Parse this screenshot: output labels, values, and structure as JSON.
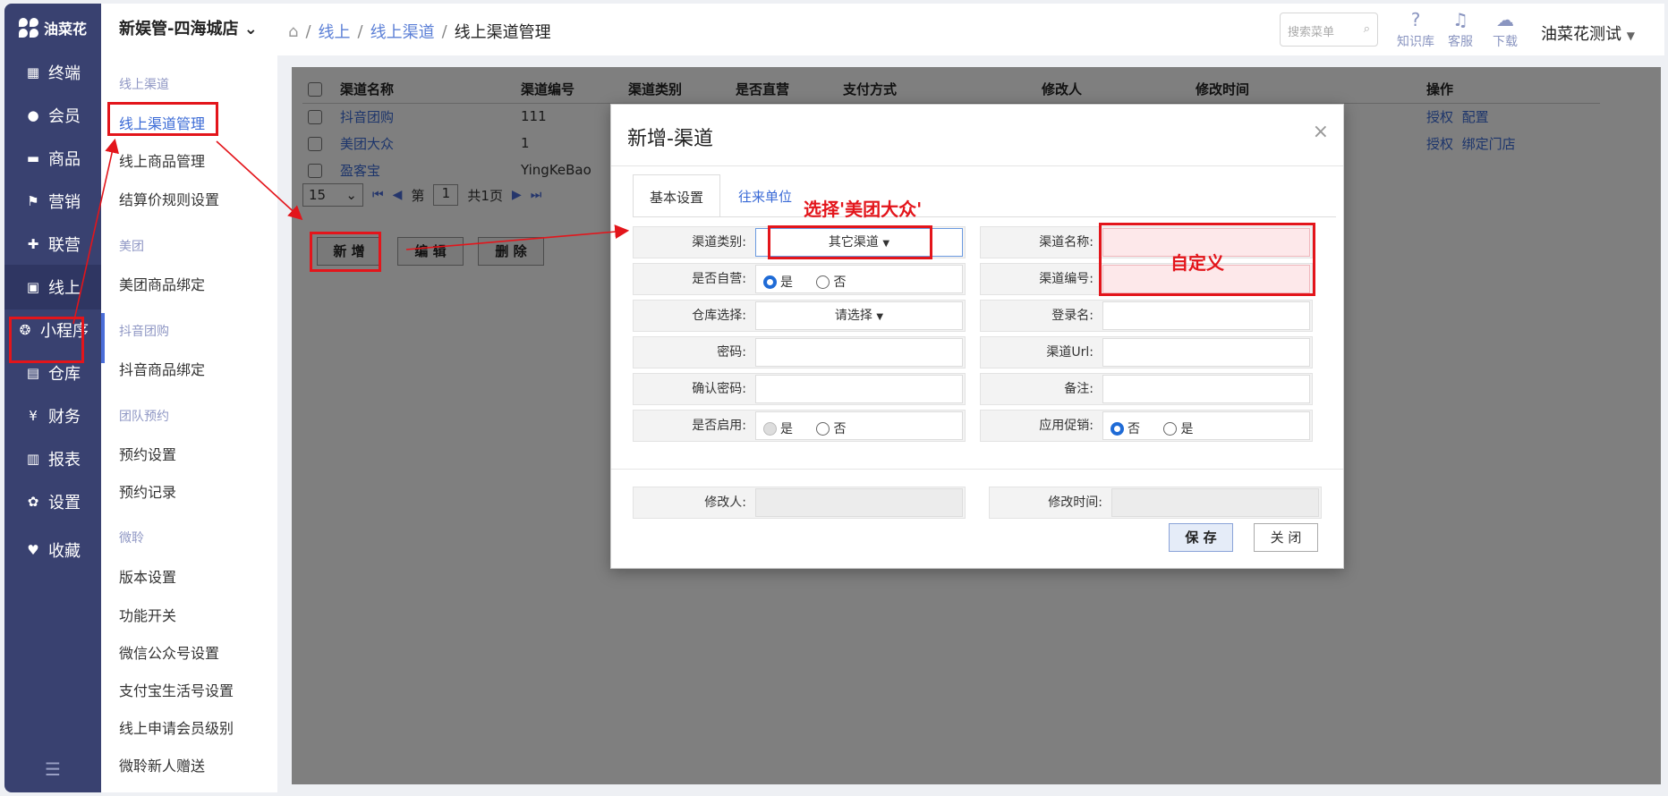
{
  "left_nav": {
    "logo": "油菜花",
    "items": [
      {
        "label": "终端",
        "icon": "terminal-icon",
        "glyph": "▦"
      },
      {
        "label": "会员",
        "icon": "member-icon",
        "glyph": "●"
      },
      {
        "label": "商品",
        "icon": "goods-icon",
        "glyph": "▬"
      },
      {
        "label": "营销",
        "icon": "flag-icon",
        "glyph": "⚑"
      },
      {
        "label": "联营",
        "icon": "union-icon",
        "glyph": "✚"
      },
      {
        "label": "线上",
        "icon": "online-icon",
        "glyph": "▣"
      },
      {
        "label": "小程序",
        "icon": "miniapp-icon",
        "glyph": "❂"
      },
      {
        "label": "仓库",
        "icon": "warehouse-icon",
        "glyph": "▤"
      },
      {
        "label": "财务",
        "icon": "finance-icon",
        "glyph": "¥"
      },
      {
        "label": "报表",
        "icon": "report-icon",
        "glyph": "▥"
      },
      {
        "label": "设置",
        "icon": "settings-icon",
        "glyph": "✿"
      },
      {
        "label": "收藏",
        "icon": "favorite-icon",
        "glyph": "♥"
      }
    ],
    "collapse_icon": "menu-collapse-icon"
  },
  "sub_nav": {
    "store": "新娱管-四海城店",
    "groups": [
      {
        "title": "线上渠道",
        "items": [
          "线上渠道管理",
          "线上商品管理",
          "结算价规则设置"
        ]
      },
      {
        "title": "美团",
        "items": [
          "美团商品绑定"
        ]
      },
      {
        "title": "抖音团购",
        "items": [
          "抖音商品绑定"
        ]
      },
      {
        "title": "团队预约",
        "items": [
          "预约设置",
          "预约记录"
        ]
      },
      {
        "title": "微聆",
        "items": [
          "版本设置",
          "功能开关",
          "微信公众号设置",
          "支付宝生活号设置",
          "线上申请会员级别",
          "微聆新人赠送"
        ]
      }
    ]
  },
  "top_bar": {
    "breadcrumb": [
      "线上",
      "线上渠道",
      "线上渠道管理"
    ],
    "search_placeholder": "搜索菜单",
    "icons": [
      {
        "label": "知识库",
        "icon": "help-icon",
        "glyph": "?"
      },
      {
        "label": "客服",
        "icon": "headset-icon",
        "glyph": "♫"
      },
      {
        "label": "下载",
        "icon": "cloud-download-icon",
        "glyph": "☁"
      }
    ],
    "user": "油菜花测试"
  },
  "table": {
    "headers": [
      "渠道名称",
      "渠道编号",
      "渠道类别",
      "是否直营",
      "支付方式",
      "修改人",
      "修改时间",
      "操作"
    ],
    "rows": [
      {
        "name": "抖音团购",
        "code": "111",
        "ops": [
          "授权",
          "配置"
        ]
      },
      {
        "name": "美团大众",
        "code": "1",
        "ops": [
          "授权",
          "绑定门店"
        ]
      },
      {
        "name": "盈客宝",
        "code": "YingKeBao",
        "ops": []
      }
    ],
    "pager": {
      "page_size": "15",
      "page_prefix": "第",
      "page": "1",
      "total": "共1页"
    },
    "buttons": [
      "新 增",
      "编 辑",
      "删 除"
    ]
  },
  "dialog": {
    "title": "新增-渠道",
    "tabs": [
      "基本设置",
      "往来单位"
    ],
    "left_fields": [
      {
        "label": "渠道类别:",
        "value": "其它渠道"
      },
      {
        "label": "是否自营:",
        "options": [
          "是",
          "否"
        ]
      },
      {
        "label": "仓库选择:",
        "value": "请选择"
      },
      {
        "label": "密码:",
        "value": ""
      },
      {
        "label": "确认密码:",
        "value": ""
      },
      {
        "label": "是否启用:",
        "options": [
          "是",
          "否"
        ]
      }
    ],
    "right_fields": [
      {
        "label": "渠道名称:",
        "value": ""
      },
      {
        "label": "渠道编号:",
        "value": ""
      },
      {
        "label": "登录名:",
        "value": ""
      },
      {
        "label": "渠道Url:",
        "value": ""
      },
      {
        "label": "备注:",
        "value": ""
      },
      {
        "label": "应用促销:",
        "options": [
          "否",
          "是"
        ]
      }
    ],
    "footer_fields": [
      {
        "label": "修改人:",
        "value": ""
      },
      {
        "label": "修改时间:",
        "value": ""
      }
    ],
    "save": "保 存",
    "close": "关 闭"
  },
  "annotations": {
    "select_note": "选择'美团大众'",
    "custom_note": "自定义",
    "color": "#e3151b"
  }
}
